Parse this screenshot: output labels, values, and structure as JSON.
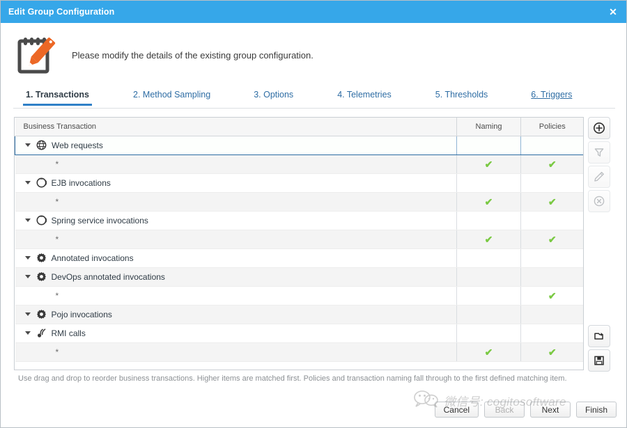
{
  "window": {
    "title": "Edit Group Configuration",
    "close_label": "✕",
    "titlebar_color": "#36a7e9"
  },
  "header": {
    "icon": "notepad-pencil-icon",
    "message": "Please modify the details of the existing group configuration."
  },
  "tabs": [
    {
      "label": "1. Transactions",
      "state": "active"
    },
    {
      "label": "2. Method Sampling",
      "state": "normal"
    },
    {
      "label": "3. Options",
      "state": "normal"
    },
    {
      "label": "4. Telemetries",
      "state": "normal"
    },
    {
      "label": "5. Thresholds",
      "state": "normal"
    },
    {
      "label": "6. Triggers",
      "state": "hover"
    }
  ],
  "table": {
    "columns": [
      "Business Transaction",
      "Naming",
      "Policies"
    ],
    "rows": [
      {
        "type": "group",
        "label": "Web requests",
        "icon": "globe-icon",
        "naming": false,
        "policies": false,
        "selected": true,
        "shade": "plain"
      },
      {
        "type": "child",
        "label": "*",
        "icon": "",
        "naming": true,
        "policies": true,
        "selected": false,
        "shade": "alt"
      },
      {
        "type": "group",
        "label": "EJB invocations",
        "icon": "ejb-icon",
        "naming": false,
        "policies": false,
        "selected": false,
        "shade": "plain"
      },
      {
        "type": "child",
        "label": "*",
        "icon": "",
        "naming": true,
        "policies": true,
        "selected": false,
        "shade": "alt"
      },
      {
        "type": "group",
        "label": "Spring service invocations",
        "icon": "ejb-icon",
        "naming": false,
        "policies": false,
        "selected": false,
        "shade": "plain"
      },
      {
        "type": "child",
        "label": "*",
        "icon": "",
        "naming": true,
        "policies": true,
        "selected": false,
        "shade": "alt"
      },
      {
        "type": "group",
        "label": "Annotated invocations",
        "icon": "gear-icon",
        "naming": false,
        "policies": false,
        "selected": false,
        "shade": "plain"
      },
      {
        "type": "group",
        "label": "DevOps annotated invocations",
        "icon": "gear-icon",
        "naming": false,
        "policies": false,
        "selected": false,
        "shade": "alt"
      },
      {
        "type": "child",
        "label": "*",
        "icon": "",
        "naming": false,
        "policies": true,
        "selected": false,
        "shade": "plain"
      },
      {
        "type": "group",
        "label": "Pojo invocations",
        "icon": "gear-icon",
        "naming": false,
        "policies": false,
        "selected": false,
        "shade": "alt"
      },
      {
        "type": "group",
        "label": "RMI calls",
        "icon": "rmi-icon",
        "naming": false,
        "policies": false,
        "selected": false,
        "shade": "plain"
      },
      {
        "type": "child",
        "label": "*",
        "icon": "",
        "naming": true,
        "policies": true,
        "selected": false,
        "shade": "alt"
      }
    ],
    "check_glyph": "✔",
    "check_color": "#7ac943"
  },
  "toolbar": {
    "top": [
      {
        "icon": "add-circle-icon",
        "enabled": true
      },
      {
        "icon": "filter-icon",
        "enabled": false
      },
      {
        "icon": "edit-pencil-icon",
        "enabled": false
      },
      {
        "icon": "delete-circle-icon",
        "enabled": false
      }
    ],
    "bottom": [
      {
        "icon": "import-folder-icon",
        "enabled": true
      },
      {
        "icon": "save-floppy-icon",
        "enabled": true
      }
    ]
  },
  "hint": "Use drag and drop to reorder business transactions. Higher items are matched first. Policies and transaction naming fall through to the first defined matching item.",
  "footer": {
    "cancel": "Cancel",
    "back": "Back",
    "next": "Next",
    "finish": "Finish"
  },
  "watermark": {
    "text": "微信号: cogitosoftware",
    "icon": "wechat-icon"
  }
}
